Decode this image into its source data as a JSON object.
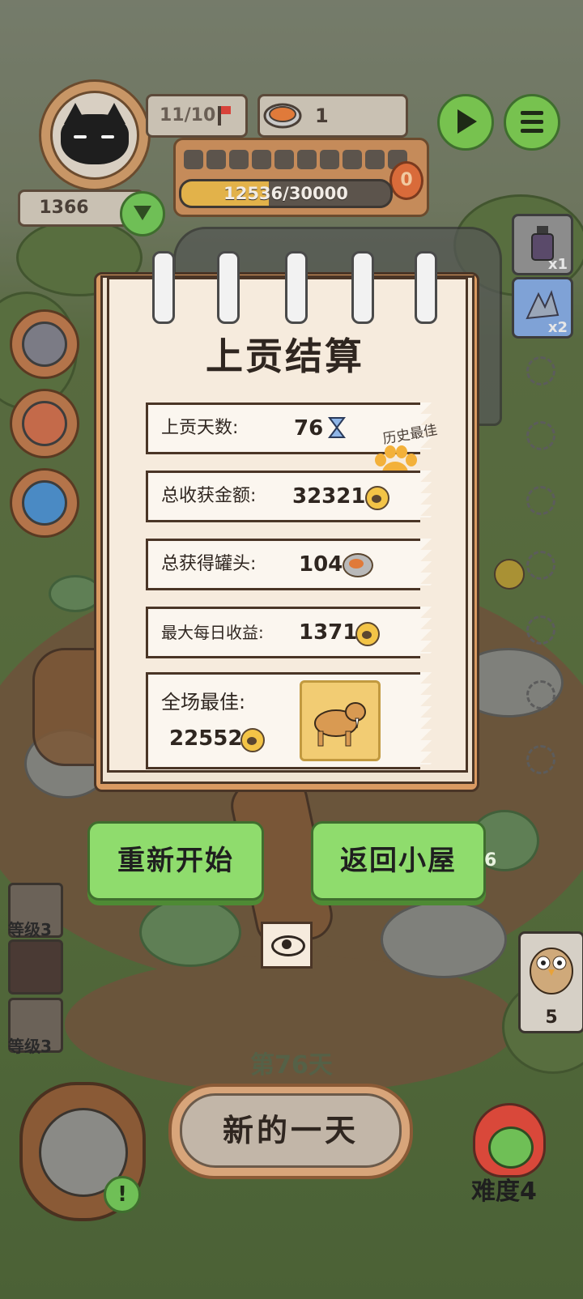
{
  "hud": {
    "score": "1366",
    "day_progress": "11/10",
    "cans": "1",
    "xp_text": "12536/30000",
    "xp_fraction": 0.418,
    "coin_badge": "0",
    "segments": 10
  },
  "side_items": [
    {
      "icon": "potion-bottle-icon",
      "count": "x1"
    },
    {
      "icon": "claw-hand-icon",
      "count": "x2"
    }
  ],
  "dialog": {
    "title": "上贡结算",
    "best_label": "历史最佳",
    "rows": [
      {
        "label": "上贡天数:",
        "value": "76",
        "icon": "hourglass-icon"
      },
      {
        "label": "总收获金额:",
        "value": "32321",
        "icon": "paw-coin-icon"
      },
      {
        "label": "总获得罐头:",
        "value": "104",
        "icon": "can-icon"
      },
      {
        "label": "最大每日收益:",
        "value": "1371",
        "icon": "paw-coin-icon"
      }
    ],
    "best_overall": {
      "label": "全场最佳:",
      "value": "22552",
      "icon": "paw-coin-icon"
    }
  },
  "buttons": {
    "restart": "重新开始",
    "return_home": "返回小屋"
  },
  "levels": [
    "等级3",
    "等级3"
  ],
  "bottom": {
    "day_label": "第76天",
    "new_day": "新的一天",
    "difficulty": "难度4",
    "alert": "!",
    "owl_count": "5",
    "pad_count": "6"
  },
  "colors": {
    "accent_green": "#8fdc6d",
    "paper": "#f6ebdd",
    "coin_yellow": "#f3c447"
  }
}
